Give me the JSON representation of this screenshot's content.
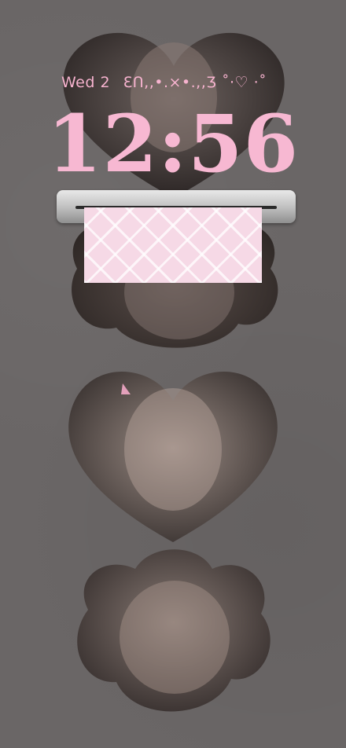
{
  "lock_screen": {
    "date": "Wed 2",
    "widget_text": "ƐՈ,,•.×•.,,Ʒ ˚·♡ ·˚",
    "time": "12:56"
  },
  "colors": {
    "accent_pink": "#f7b8d2",
    "background": "#6b6767"
  }
}
